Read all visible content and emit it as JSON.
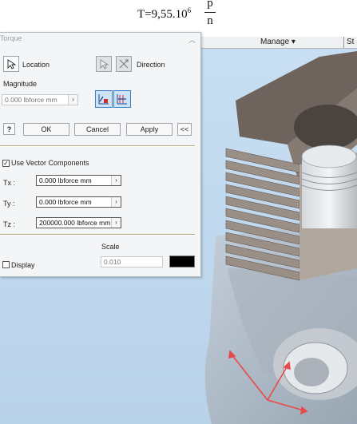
{
  "formula": {
    "lhs": "T=9,55.10",
    "exp": "6",
    "numerator": "p",
    "denominator": "n"
  },
  "ribbon": {
    "manage_label": "Manage ▾",
    "next_tab": "St"
  },
  "dialog": {
    "title": "Torque",
    "location_label": "Location",
    "direction_label": "Direction",
    "magnitude_label": "Magnitude",
    "magnitude_value": "0.000 lbforce mm",
    "ok_label": "OK",
    "cancel_label": "Cancel",
    "apply_label": "Apply",
    "more_label": "<<",
    "use_vector_label": "Use Vector Components",
    "use_vector_checked": true,
    "tx_label": "Tx :",
    "tx_value": "0.000 lbforce mm",
    "ty_label": "Ty :",
    "ty_value": "0.000 lbforce mm",
    "tz_label": "Tz :",
    "tz_value": "200000.000 lbforce mm",
    "scale_label": "Scale",
    "scale_value": "0.010",
    "display_label": "Display",
    "display_checked": false,
    "display_color": "#000000"
  },
  "icons": [
    "select-arrow-icon",
    "direction-flip-icon",
    "graph-icon",
    "help-icon",
    "dropdown-arrow-icon"
  ]
}
